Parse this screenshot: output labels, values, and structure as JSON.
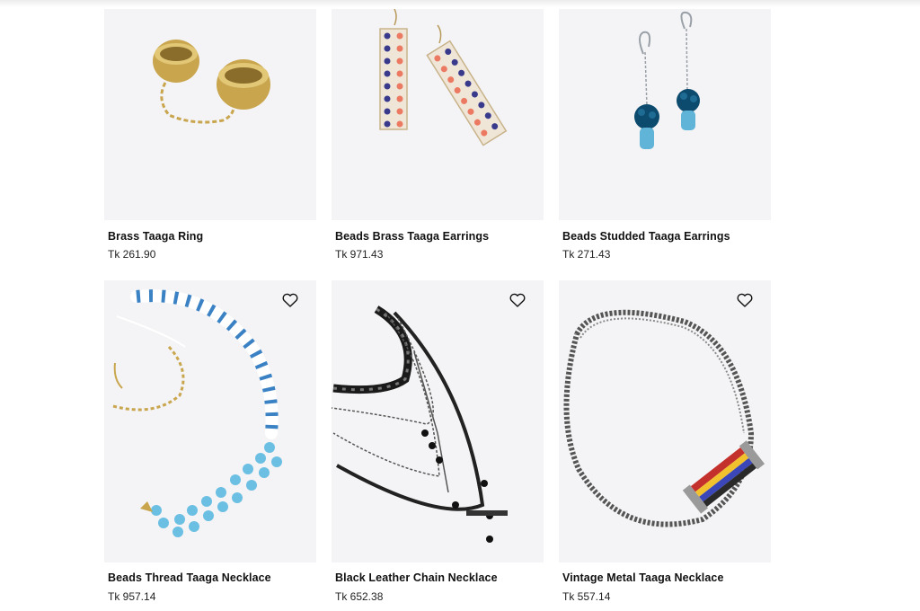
{
  "products": [
    {
      "name": "Brass Taaga Ring",
      "price": "Tk 261.90",
      "image": "brass-rings-chain",
      "wishlist": false
    },
    {
      "name": "Beads Brass Taaga Earrings",
      "price": "Tk 971.43",
      "image": "bead-ladder-earrings",
      "wishlist": false
    },
    {
      "name": "Beads Studded Taaga Earrings",
      "price": "Tk 271.43",
      "image": "blue-drop-earrings",
      "wishlist": false
    },
    {
      "name": "Beads Thread Taaga Necklace",
      "price": "Tk 957.14",
      "image": "blue-bead-necklace",
      "wishlist": true
    },
    {
      "name": "Black Leather Chain Necklace",
      "price": "Tk 652.38",
      "image": "black-layered-necklace",
      "wishlist": true
    },
    {
      "name": "Vintage Metal Taaga Necklace",
      "price": "Tk 557.14",
      "image": "metal-chain-necklace",
      "wishlist": true
    }
  ],
  "icons": {
    "wishlist": "heart-outline-icon"
  },
  "colors": {
    "background": "#ffffff",
    "image_background": "#f4f4f6",
    "text": "#111111"
  }
}
